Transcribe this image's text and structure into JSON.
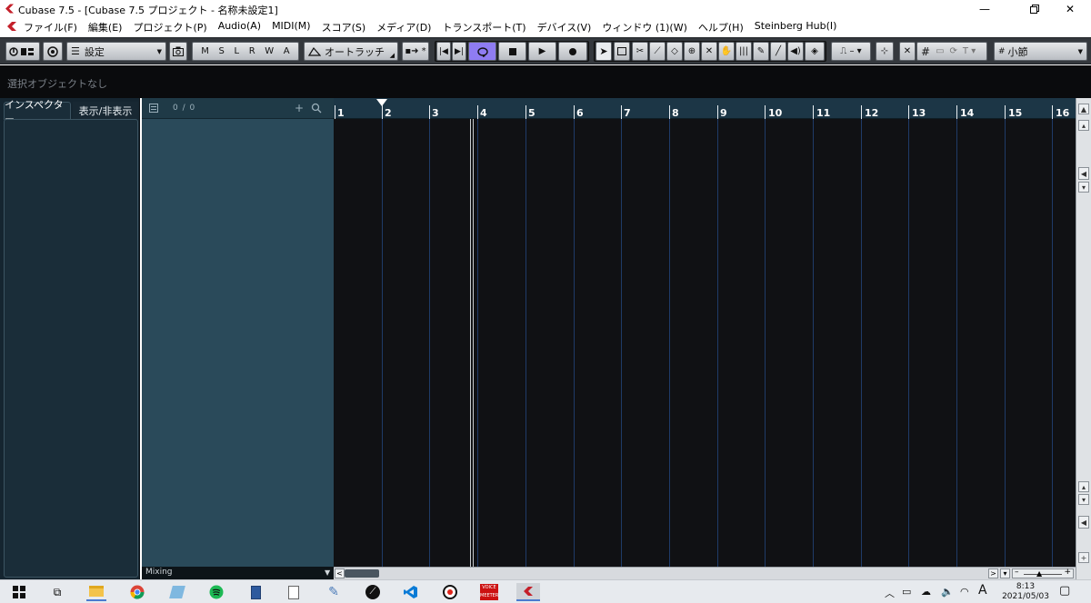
{
  "window": {
    "title": "Cubase 7.5 - [Cubase 7.5 プロジェクト - 名称未設定1]",
    "minimize_icon": "minimize-icon",
    "maximize_icon": "restore-icon",
    "close_icon": "close-icon"
  },
  "menubar": {
    "items": [
      "ファイル(F)",
      "編集(E)",
      "プロジェクト(P)",
      "Audio(A)",
      "MIDI(M)",
      "スコア(S)",
      "メディア(D)",
      "トランスポート(T)",
      "デバイス(V)",
      "ウィンドウ (1)(W)",
      "ヘルプ(H)",
      "Steinberg Hub(I)"
    ]
  },
  "toolbar": {
    "preset_label": "設定",
    "automation_buttons": [
      "M",
      "S",
      "L",
      "R",
      "W",
      "A"
    ],
    "automation_mode": "オートラッチ",
    "snap_mode": "小節",
    "accent_color": "#8f7cf2"
  },
  "infoline": {
    "text": "選択オブジェクトなし"
  },
  "inspector": {
    "tab_inspector": "インスペクター",
    "tab_visibility": "表示/非表示"
  },
  "tracklist": {
    "count": "0 / 0",
    "footer_label": "Mixing"
  },
  "ruler": {
    "bars": [
      "1",
      "2",
      "3",
      "4",
      "5",
      "6",
      "7",
      "8",
      "9",
      "10",
      "11",
      "12",
      "13",
      "14",
      "15",
      "16"
    ]
  },
  "taskbar": {
    "apps": [
      "windows-start-icon",
      "task-view-icon",
      "file-explorer-icon",
      "chrome-icon",
      "notepad-icon",
      "spotify-icon",
      "calculator-icon",
      "document-icon",
      "paint-icon",
      "app-icon",
      "vscode-icon",
      "record-icon",
      "voicemeeter-icon",
      "cubase-icon"
    ],
    "clock_time": "8:13",
    "clock_date": "2021/05/03",
    "ime_label": "A"
  }
}
